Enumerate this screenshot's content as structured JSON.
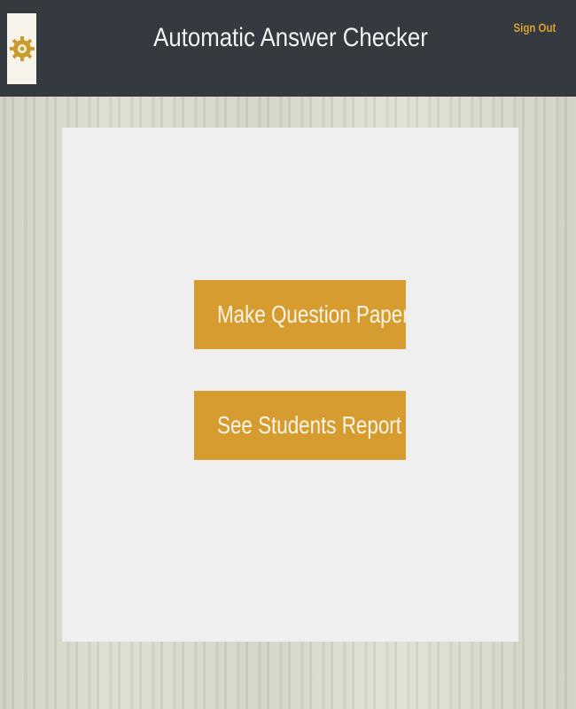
{
  "header": {
    "title": "Automatic Answer Checker",
    "sign_out_label": "Sign Out",
    "logo_icon": "gear-emblem-icon"
  },
  "main": {
    "buttons": [
      {
        "label": "Make Question Paper"
      },
      {
        "label": "See Students Report"
      }
    ]
  },
  "colors": {
    "header_bg": "#343a40",
    "accent": "#d69c2f",
    "card_bg": "#efefef"
  }
}
